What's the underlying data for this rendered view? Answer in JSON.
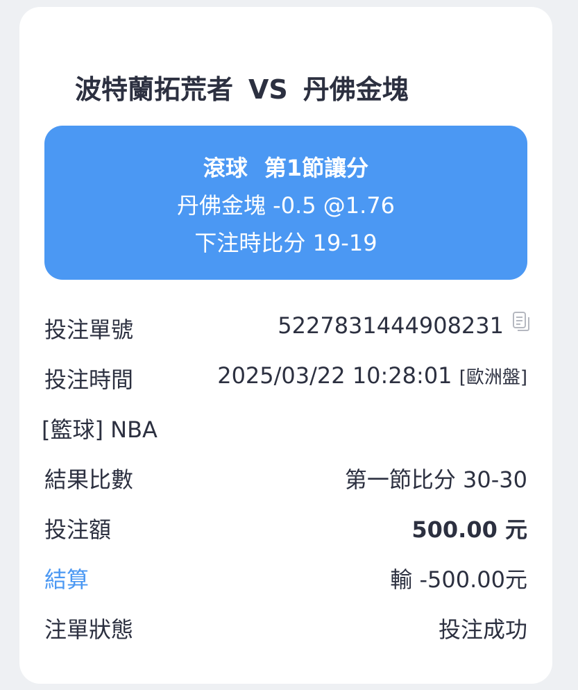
{
  "header": {
    "home_team": "波特蘭拓荒者",
    "vs": "VS",
    "away_team": "丹佛金塊"
  },
  "bet_banner": {
    "play_type": "滾球",
    "market": "第1節讓分",
    "selection": "丹佛金塊 -0.5 @1.76",
    "score_at_bet": "下注時比分 19-19"
  },
  "details": {
    "order_no_label": "投注單號",
    "order_no": "5227831444908231",
    "bet_time_label": "投注時間",
    "bet_time": "2025/03/22 10:28:01",
    "odds_type": "[歐洲盤]",
    "league": "[籃球] NBA",
    "result_label": "結果比數",
    "result_score": "第一節比分 30-30",
    "stake_label": "投注額",
    "stake": "500.00 元",
    "settlement_label": "結算",
    "settlement": "輸 -500.00元",
    "status_label": "注單狀態",
    "status": "投注成功"
  },
  "colors": {
    "accent": "#4b98f3",
    "text": "#2c3040",
    "background": "#eef0f3",
    "card": "#ffffff"
  },
  "icons": {
    "copy": "copy-icon"
  }
}
